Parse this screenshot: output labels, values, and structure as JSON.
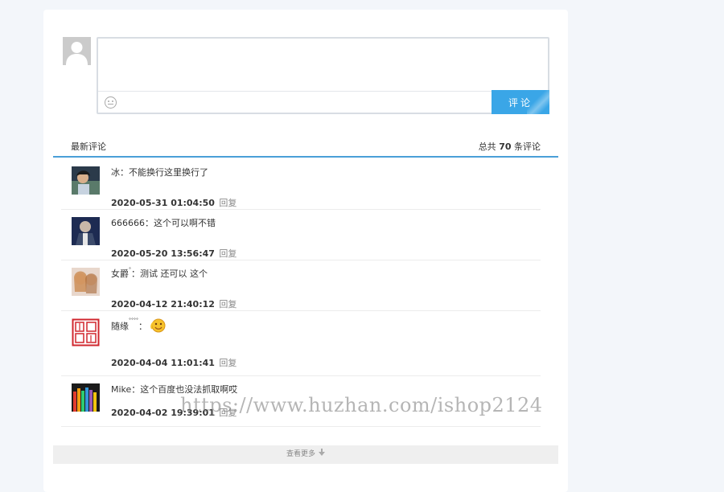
{
  "composer": {
    "placeholder": "",
    "submit_label": "评论"
  },
  "list_header": {
    "title": "最新评论",
    "count_prefix": "总共",
    "count_value": "70",
    "count_suffix": "条评论"
  },
  "comments": [
    {
      "author": "冰",
      "sup": "",
      "sep": "：",
      "text": "不能换行这里换行了",
      "date": "2020-05-31 01:04:50",
      "reply": "回复"
    },
    {
      "author": "666666",
      "sup": "",
      "sep": "：",
      "text": "这个可以啊不错",
      "date": "2020-05-20 13:56:47",
      "reply": "回复"
    },
    {
      "author": "女爵",
      "sup": "°",
      "sep": "：",
      "text": "测试 还可以 这个",
      "date": "2020-04-12 21:40:12",
      "reply": "回复"
    },
    {
      "author": "随缘",
      "sup": "°°°°",
      "sep": "：",
      "text": "",
      "date": "2020-04-04 11:01:41",
      "reply": "回复"
    },
    {
      "author": "Mike",
      "sup": "",
      "sep": "：",
      "text": "这个百度也没法抓取啊哎",
      "date": "2020-04-02 19:39:01",
      "reply": "回复"
    }
  ],
  "more_label": "查看更多",
  "watermark": "https://www.huzhan.com/ishop2124",
  "colors": {
    "accent": "#3aa6e7",
    "header_line": "#4a9fd8",
    "background": "#f3f6fa"
  }
}
